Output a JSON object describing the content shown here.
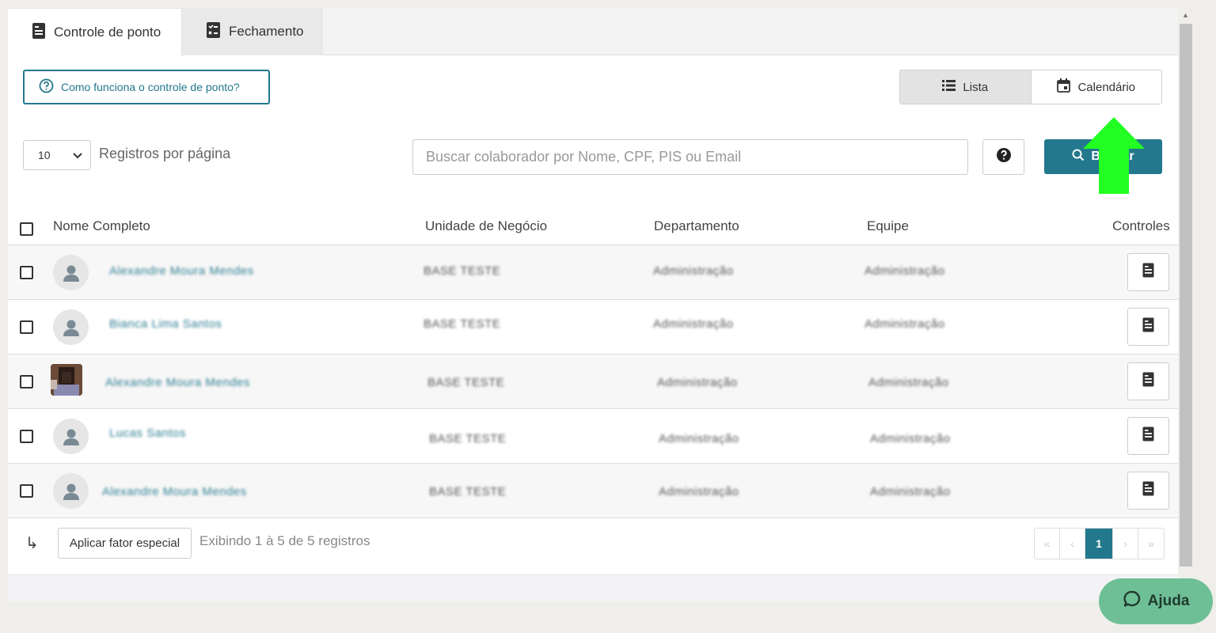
{
  "tabs": [
    {
      "label": "Controle de ponto",
      "icon": "document-icon",
      "active": true
    },
    {
      "label": "Fechamento",
      "icon": "checklist-icon",
      "active": false
    }
  ],
  "help_link": "Como funciona o controle de ponto?",
  "view_toggle": {
    "list": "Lista",
    "calendar": "Calendário",
    "active": "Lista"
  },
  "per_page": {
    "value": "10",
    "label": "Registros por página"
  },
  "search": {
    "placeholder": "Buscar colaborador por Nome, CPF, PIS ou Email",
    "button_label": "Buscar"
  },
  "table": {
    "headers": [
      "Nome Completo",
      "Unidade de Negócio",
      "Departamento",
      "Equipe",
      "Controles"
    ],
    "rows": [
      {
        "name": "Alexandre Moura Mendes",
        "unit": "BASE TESTE",
        "department": "Administração",
        "team": "Administração",
        "avatar": "placeholder"
      },
      {
        "name": "Bianca Lima Santos",
        "unit": "BASE TESTE",
        "department": "Administração",
        "team": "Administração",
        "avatar": "placeholder"
      },
      {
        "name": "Alexandre Moura Mendes",
        "unit": "BASE TESTE",
        "department": "Administração",
        "team": "Administração",
        "avatar": "photo"
      },
      {
        "name": "Lucas Santos",
        "unit": "BASE TESTE",
        "department": "Administração",
        "team": "Administração",
        "avatar": "placeholder"
      },
      {
        "name": "Alexandre Moura Mendes",
        "unit": "BASE TESTE",
        "department": "Administração",
        "team": "Administração",
        "avatar": "placeholder"
      }
    ]
  },
  "footer": {
    "apply_button": "Aplicar fator especial",
    "showing": "Exibindo 1  à 5  de 5  registros",
    "pager": {
      "first": "«",
      "prev": "‹",
      "current": "1",
      "next": "›",
      "last": "»"
    }
  },
  "help_widget": "Ajuda",
  "colors": {
    "accent": "#23788d",
    "highlight_arrow": "#22ff22",
    "help_widget": "#6ebf95"
  }
}
